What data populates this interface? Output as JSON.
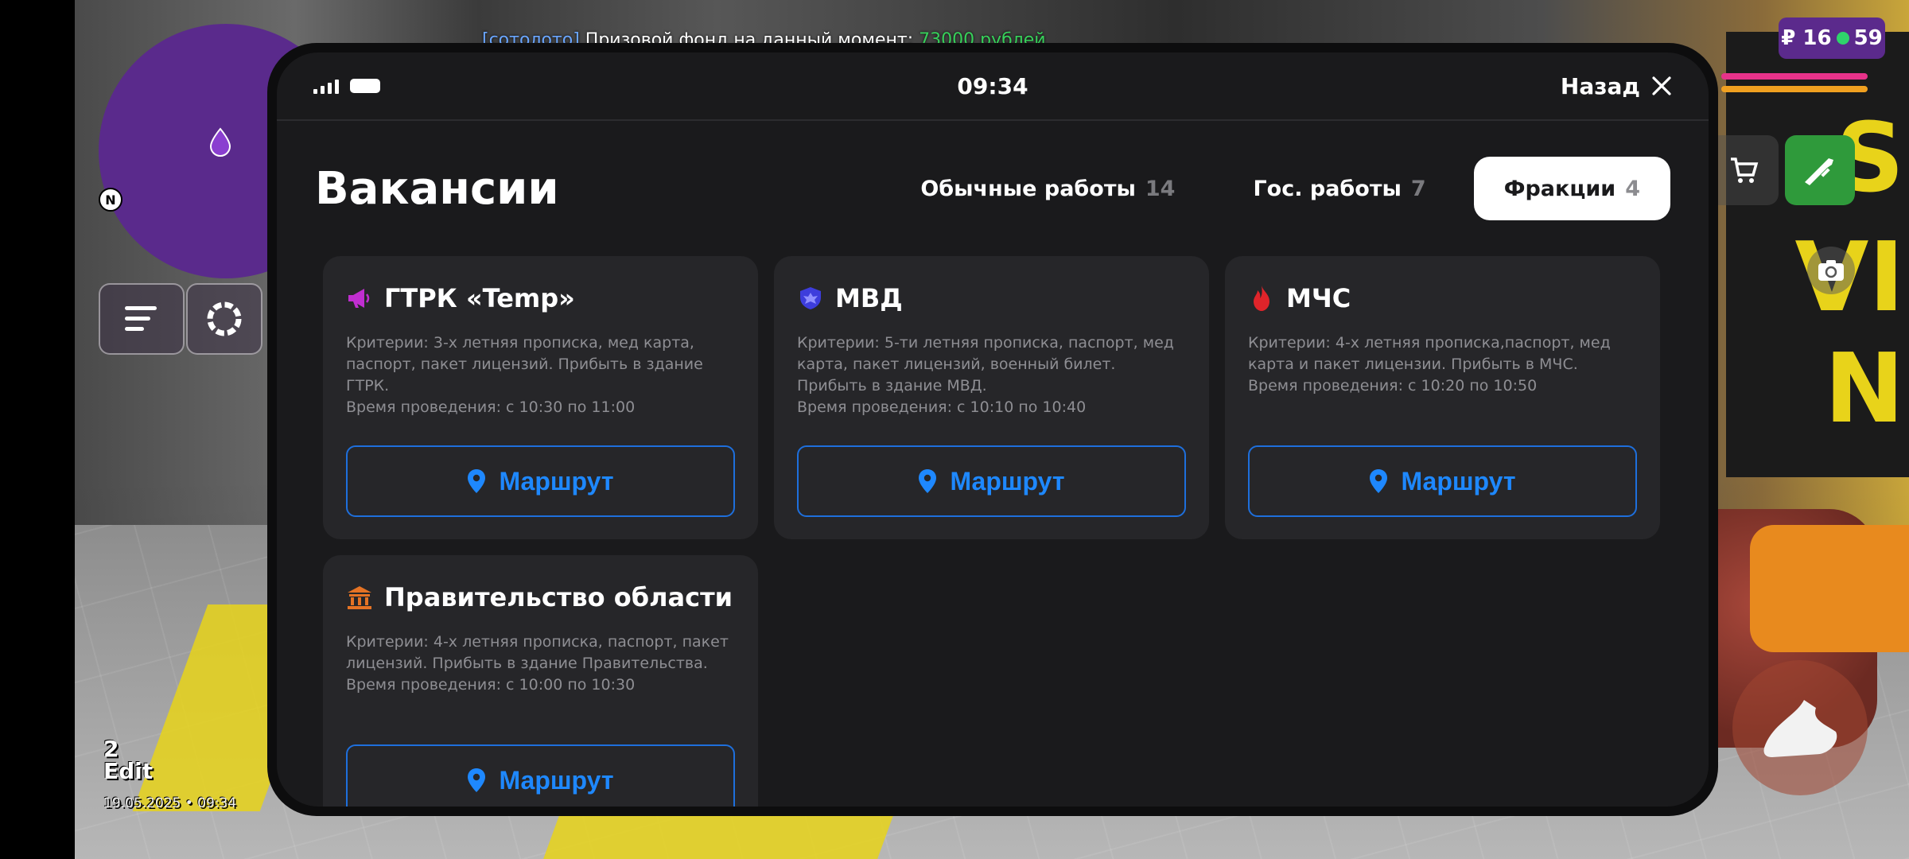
{
  "hud": {
    "chat_tag": "[сотолото]",
    "chat_text": " Призовой фонд на данный момент: ",
    "chat_amount": "73000 рублей",
    "money_left": "₽ 16",
    "money_right": "59",
    "north": "N",
    "watermark_num": "2",
    "watermark_edit": "Edit",
    "watermark_date": "19.05.2025 • 09:34"
  },
  "status": {
    "time": "09:34",
    "back_label": "Назад"
  },
  "page": {
    "title": "Вакансии"
  },
  "tabs": [
    {
      "label": "Обычные работы",
      "count": "14",
      "active": false
    },
    {
      "label": "Гос. работы",
      "count": "7",
      "active": false
    },
    {
      "label": "Фракции",
      "count": "4",
      "active": true
    }
  ],
  "cards": [
    {
      "title": "ГТРК «Temp»",
      "icon": "megaphone-icon",
      "icon_color": "#c02ed0",
      "description": "Критерии: 3-х летняя прописка, мед карта, паспорт, пакет лицензий. Прибыть в здание ГТРК.",
      "time": "Время проведения: с 10:30 по 11:00",
      "button": "Маршрут"
    },
    {
      "title": "МВД",
      "icon": "police-shield-icon",
      "icon_color": "#3d3ddc",
      "description": "Критерии: 5-ти летняя прописка, паспорт, мед карта, пакет лицензий, военный билет. Прибыть в здание МВД.",
      "time": "Время проведения: с 10:10 по 10:40",
      "button": "Маршрут"
    },
    {
      "title": "МЧС",
      "icon": "fire-icon",
      "icon_color": "#e0242a",
      "description": "Критерии: 4-х летняя прописка,паспорт, мед карта  и пакет лицензии. Прибыть в МЧС.",
      "time": "Время проведения: с 10:20 по 10:50",
      "button": "Маршрут"
    },
    {
      "title": "Правительство области",
      "icon": "government-building-icon",
      "icon_color": "#e57324",
      "description": "Критерии: 4-х летняя прописка, паспорт, пакет лицензий. Прибыть в здание Правительства.",
      "time": "Время проведения: с 10:00 по 10:30",
      "button": "Маршрут"
    }
  ],
  "colors": {
    "accent_blue": "#1e88ff",
    "card_bg": "#262629",
    "screen_bg": "#1a1a1c"
  }
}
